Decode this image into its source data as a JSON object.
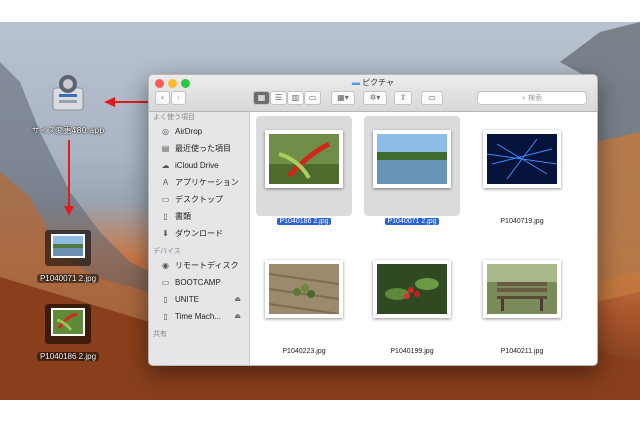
{
  "window": {
    "title": "ピクチャ",
    "search_placeholder": "検索"
  },
  "desktop": {
    "app_icon_label": "サイズ変更480.app",
    "dropped_files": [
      "P1040071 2.jpg",
      "P1040186 2.jpg"
    ]
  },
  "sidebar": {
    "favorites_header": "よく使う項目",
    "favorites": [
      {
        "label": "AirDrop",
        "icon": "airdrop-icon"
      },
      {
        "label": "最近使った項目",
        "icon": "recents-icon"
      },
      {
        "label": "iCloud Drive",
        "icon": "cloud-icon"
      },
      {
        "label": "アプリケーション",
        "icon": "applications-icon"
      },
      {
        "label": "デスクトップ",
        "icon": "desktop-icon"
      },
      {
        "label": "書類",
        "icon": "documents-icon"
      },
      {
        "label": "ダウンロード",
        "icon": "downloads-icon"
      }
    ],
    "devices_header": "デバイス",
    "devices": [
      {
        "label": "リモートディスク",
        "icon": "remote-disc-icon"
      },
      {
        "label": "BOOTCAMP",
        "icon": "disk-icon"
      },
      {
        "label": "UNITE",
        "icon": "disk-icon",
        "eject": "⏏"
      },
      {
        "label": "Time Mach...",
        "icon": "disk-icon",
        "eject": "⏏"
      }
    ],
    "shared_header": "共有"
  },
  "files": [
    {
      "name": "P1040186 2.jpg",
      "selected": true
    },
    {
      "name": "P1040071 2.jpg",
      "selected": true
    },
    {
      "name": "P1040719.jpg",
      "selected": false
    },
    {
      "name": "P1040223.jpg",
      "selected": false
    },
    {
      "name": "P1040199.jpg",
      "selected": false
    },
    {
      "name": "P1040211.jpg",
      "selected": false
    }
  ],
  "colors": {
    "selection": "#2a63d0",
    "arrow": "#e01b1b",
    "close": "#fc5f57",
    "minimize": "#fdbc2e",
    "zoom": "#28c840"
  }
}
